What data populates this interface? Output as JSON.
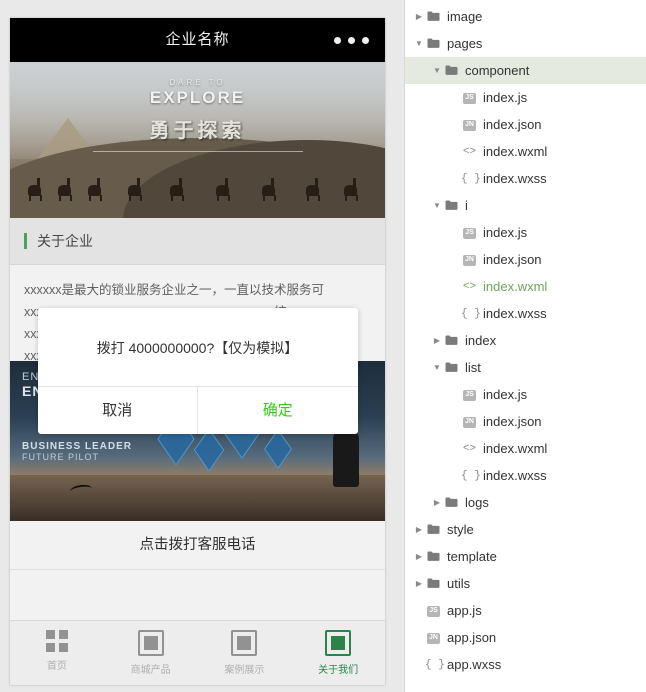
{
  "simulator": {
    "navbar": {
      "title": "企业名称",
      "menu_icon": "ellipsis-icon"
    },
    "banner": {
      "dare_to": "DARE TO",
      "explore": "EXPLORE",
      "chinese": "勇于探索",
      "arrows": ">>"
    },
    "section": {
      "title": "关于企业"
    },
    "about": {
      "text": "xxxxxx是最大的锁业服务企业之一，一直以技术服务可xxxxxxxxxxxxxxxxxxxxxxxxxxxxxxxxxxxxxxxx核xxxxxxxxxxxxxxxxxxxxxxxxxxxxxxxxxxxxxxxxxx公xxxxxxxxxxxxxxxxxxxxxxxxxxxxxxxxxxxxxxxxxx全xxxxxxxxxxxxxxxxxxxxxxxxxxxxxxxxxxxxxxxxxx"
    },
    "promo": {
      "title_line1": "ENTERPRISE",
      "title_line2": "ENTERPRISE IDEA",
      "sub_line1": "BUSINESS LEADER",
      "sub_line2": "FUTURE PILOT"
    },
    "call_row": {
      "label": "点击拨打客服电话"
    },
    "tabbar": [
      {
        "label": "首页",
        "icon": "home-icon",
        "active": false
      },
      {
        "label": "商城产品",
        "icon": "square-icon",
        "active": false
      },
      {
        "label": "案例展示",
        "icon": "square-icon",
        "active": false
      },
      {
        "label": "关于我们",
        "icon": "square-icon",
        "active": true
      }
    ],
    "modal": {
      "message": "拨打 4000000000?【仅为模拟】",
      "cancel": "取消",
      "confirm": "确定",
      "confirm_color": "#3cc51f"
    }
  },
  "tree": {
    "selected_color": "#e4eadf",
    "active_file_color": "#6fa35a",
    "items": [
      {
        "indent": 0,
        "arrow": "collapsed",
        "icon": "folder-icon",
        "label": "image",
        "selected": false,
        "active": false
      },
      {
        "indent": 0,
        "arrow": "expanded",
        "icon": "folder-icon",
        "label": "pages",
        "selected": false,
        "active": false
      },
      {
        "indent": 1,
        "arrow": "expanded",
        "icon": "folder-icon",
        "label": "component",
        "selected": true,
        "active": false
      },
      {
        "indent": 2,
        "arrow": "none",
        "icon": "js-icon",
        "label": "index.js",
        "selected": false,
        "active": false
      },
      {
        "indent": 2,
        "arrow": "none",
        "icon": "json-icon",
        "label": "index.json",
        "selected": false,
        "active": false
      },
      {
        "indent": 2,
        "arrow": "none",
        "icon": "wxml-icon",
        "label": "index.wxml",
        "selected": false,
        "active": false
      },
      {
        "indent": 2,
        "arrow": "none",
        "icon": "wxss-icon",
        "label": "index.wxss",
        "selected": false,
        "active": false
      },
      {
        "indent": 1,
        "arrow": "expanded",
        "icon": "folder-icon",
        "label": "i",
        "selected": false,
        "active": false
      },
      {
        "indent": 2,
        "arrow": "none",
        "icon": "js-icon",
        "label": "index.js",
        "selected": false,
        "active": false
      },
      {
        "indent": 2,
        "arrow": "none",
        "icon": "json-icon",
        "label": "index.json",
        "selected": false,
        "active": false
      },
      {
        "indent": 2,
        "arrow": "none",
        "icon": "wxml-icon",
        "label": "index.wxml",
        "selected": false,
        "active": true
      },
      {
        "indent": 2,
        "arrow": "none",
        "icon": "wxss-icon",
        "label": "index.wxss",
        "selected": false,
        "active": false
      },
      {
        "indent": 1,
        "arrow": "collapsed",
        "icon": "folder-icon",
        "label": "index",
        "selected": false,
        "active": false
      },
      {
        "indent": 1,
        "arrow": "expanded",
        "icon": "folder-icon",
        "label": "list",
        "selected": false,
        "active": false
      },
      {
        "indent": 2,
        "arrow": "none",
        "icon": "js-icon",
        "label": "index.js",
        "selected": false,
        "active": false
      },
      {
        "indent": 2,
        "arrow": "none",
        "icon": "json-icon",
        "label": "index.json",
        "selected": false,
        "active": false
      },
      {
        "indent": 2,
        "arrow": "none",
        "icon": "wxml-icon",
        "label": "index.wxml",
        "selected": false,
        "active": false
      },
      {
        "indent": 2,
        "arrow": "none",
        "icon": "wxss-icon",
        "label": "index.wxss",
        "selected": false,
        "active": false
      },
      {
        "indent": 1,
        "arrow": "collapsed",
        "icon": "folder-icon",
        "label": "logs",
        "selected": false,
        "active": false
      },
      {
        "indent": 0,
        "arrow": "collapsed",
        "icon": "folder-icon",
        "label": "style",
        "selected": false,
        "active": false
      },
      {
        "indent": 0,
        "arrow": "collapsed",
        "icon": "folder-icon",
        "label": "template",
        "selected": false,
        "active": false
      },
      {
        "indent": 0,
        "arrow": "collapsed",
        "icon": "folder-icon",
        "label": "utils",
        "selected": false,
        "active": false
      },
      {
        "indent": 0,
        "arrow": "none",
        "icon": "js-icon",
        "label": "app.js",
        "selected": false,
        "active": false
      },
      {
        "indent": 0,
        "arrow": "none",
        "icon": "json-icon",
        "label": "app.json",
        "selected": false,
        "active": false
      },
      {
        "indent": 0,
        "arrow": "none",
        "icon": "wxss-icon",
        "label": "app.wxss",
        "selected": false,
        "active": false
      }
    ]
  }
}
